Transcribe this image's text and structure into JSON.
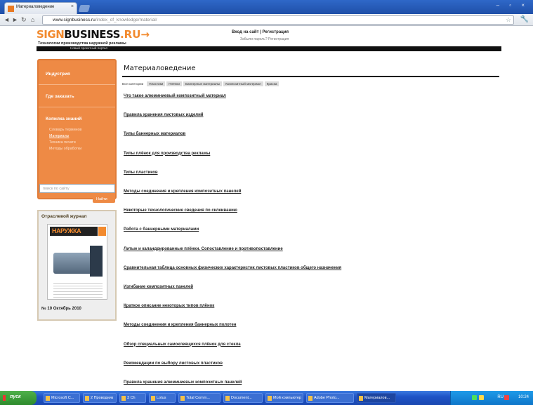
{
  "browser": {
    "tab_title": "Материаловедение",
    "tab_close": "×",
    "url_domain": "www.signbusiness.ru",
    "url_path": "/index_of_knowledge/material/",
    "back_glyph": "◄",
    "forward_glyph": "►",
    "reload_glyph": "↻",
    "home_glyph": "⌂",
    "star_glyph": "☆",
    "wrench_glyph": "🔧",
    "window_controls": "– ▫ ×"
  },
  "site": {
    "logo_sign": "SIGN",
    "logo_business": "BUSINESS",
    "logo_ru": ".RU→",
    "tagline": "Технологии производства наружной рекламы",
    "login_link": "Вход на сайт | Регистрация",
    "login_sub": "Забыли пароль? Регистрация",
    "blackbar_text": "Новый проектный портал"
  },
  "sidebar": {
    "nav": [
      {
        "label": "Индустрия",
        "type": "head"
      },
      {
        "label": "Где заказать",
        "type": "head"
      },
      {
        "label": "Копилка знаний",
        "type": "head"
      },
      {
        "label": "Словарь терминов",
        "type": "sub"
      },
      {
        "label": "Материалы",
        "type": "sub",
        "selected": true
      },
      {
        "label": "Техника печати",
        "type": "sub"
      },
      {
        "label": "Методы обработки",
        "type": "sub"
      }
    ],
    "search_placeholder": "поиск по сайту",
    "search_button": "Найти",
    "journal_title": "Отраслевой журнал",
    "journal_mast": "НАРУЖКА",
    "journal_issue": "№ 10 Октябрь 2010"
  },
  "main": {
    "title": "Материаловедение",
    "filters": [
      "Все категории",
      "Пластики",
      "Плёнки",
      "Баннерные материалы",
      "Композитный материал",
      "Краска"
    ],
    "articles": [
      "Что такое алюминиевый композитный материал",
      "Правила хранения листовых изделий",
      "Типы баннерных материалов",
      "Типы плёнок для производства рекламы",
      "Типы пластиков",
      "Методы соединения и крепления композитных панелей",
      "Некоторые технологические сведения по склеиванию",
      "Работа с баннерными материалами",
      "Литые и каландрированные плёнки. Сопоставление и противопоставление",
      "Сравнительная таблица основных физических характеристик листовых пластиков общего назначения",
      "Изгибание композитных панелей",
      "Краткое описание некоторых типов плёнок",
      "Методы соединения и крепления баннерных полотен",
      "Обзор специальных самоклеящихся плёнок для стекла",
      "Рекомендации по выбору листовых пластиков",
      "Правила хранения алюминиевых композитных панелей"
    ]
  },
  "taskbar": {
    "start": "пуск",
    "buttons": [
      "Microsoft C...",
      "2 Проводник",
      "3 Ch",
      "Lotus",
      "Total Comm...",
      "Document...",
      "Мой компьютер",
      "Adobe Photo...",
      "Материалов..."
    ],
    "active_index": 8,
    "lang": "RU",
    "clock": "10:24"
  }
}
